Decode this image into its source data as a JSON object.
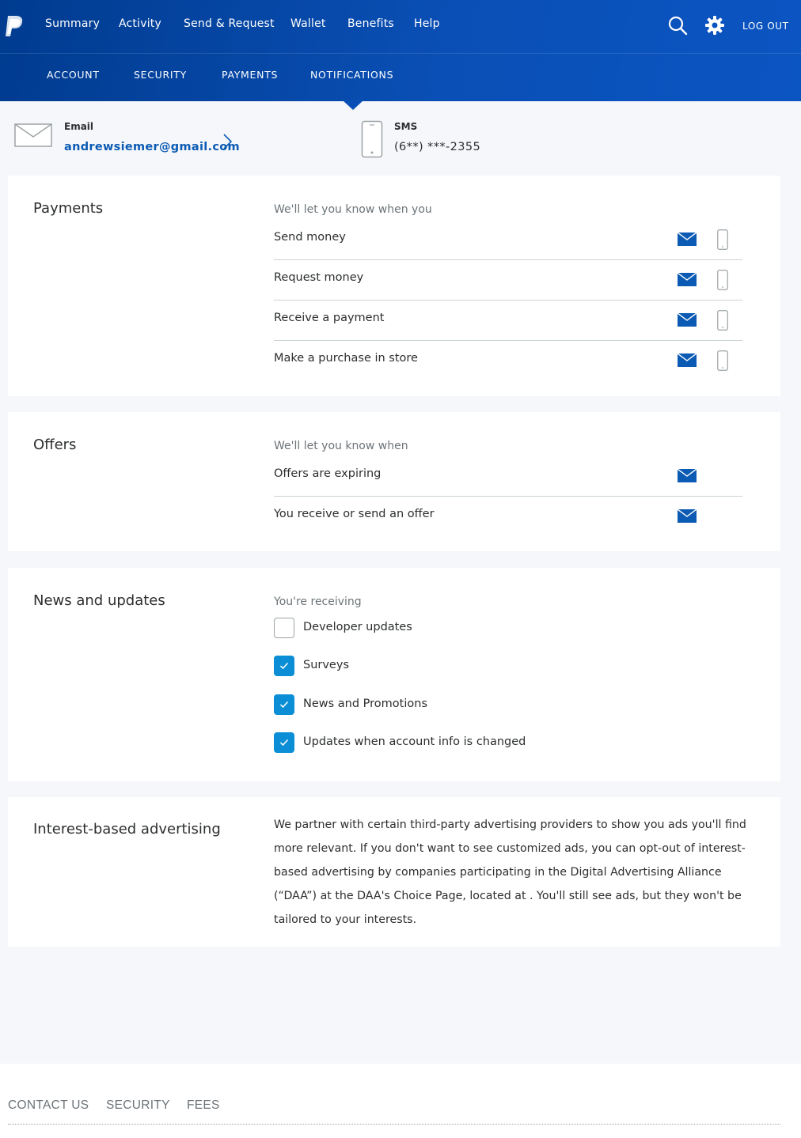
{
  "colors": {
    "header": "#0a4fb5",
    "accent": "#0b5ab3",
    "checkbox": "#0b8ed6",
    "mail_icon": "#0b5ab3"
  },
  "topnav": {
    "logo": "paypal-logo",
    "items": [
      {
        "label": "Summary"
      },
      {
        "label": "Activity"
      },
      {
        "label": "Send & Request"
      },
      {
        "label": "Wallet"
      },
      {
        "label": "Benefits"
      },
      {
        "label": "Help"
      }
    ],
    "search_icon": "search-icon",
    "settings_icon": "gear-icon",
    "logout_label": "LOG OUT"
  },
  "subnav": {
    "items": [
      {
        "label": "ACCOUNT"
      },
      {
        "label": "SECURITY"
      },
      {
        "label": "PAYMENTS"
      },
      {
        "label": "NOTIFICATIONS",
        "active": true
      }
    ]
  },
  "contact": {
    "email_label": "Email",
    "email_value": "andrewsiemer@gmail.com",
    "sms_label": "SMS",
    "sms_value": "(6**) ***-2355"
  },
  "payments": {
    "title": "Payments",
    "subtitle": "We'll let you know when you",
    "rows": [
      {
        "label": "Send money",
        "email": true,
        "sms": false
      },
      {
        "label": "Request money",
        "email": true,
        "sms": false
      },
      {
        "label": "Receive a payment",
        "email": true,
        "sms": false
      },
      {
        "label": "Make a purchase in store",
        "email": true,
        "sms": false
      }
    ]
  },
  "offers": {
    "title": "Offers",
    "subtitle": "We'll let you know when",
    "rows": [
      {
        "label": "Offers are expiring",
        "email": true
      },
      {
        "label": "You receive or send an offer",
        "email": true
      }
    ]
  },
  "news": {
    "title": "News and updates",
    "subtitle": "You're receiving",
    "items": [
      {
        "label": "Developer updates",
        "checked": false
      },
      {
        "label": "Surveys",
        "checked": true
      },
      {
        "label": "News and Promotions",
        "checked": true
      },
      {
        "label": "Updates when account info is changed",
        "checked": true
      }
    ]
  },
  "advertising": {
    "title": "Interest-based advertising",
    "text": "We partner with certain third-party advertising providers to show you ads you'll find more relevant. If you don't want to see customized ads, you can opt-out of interest-based advertising by companies participating in the Digital Advertising Alliance (“DAA”) at the DAA's Choice Page, located at . You'll still see ads, but they won't be tailored to your interests."
  },
  "footer": {
    "links": [
      {
        "label": "CONTACT US"
      },
      {
        "label": "SECURITY"
      },
      {
        "label": "FEES"
      }
    ]
  }
}
